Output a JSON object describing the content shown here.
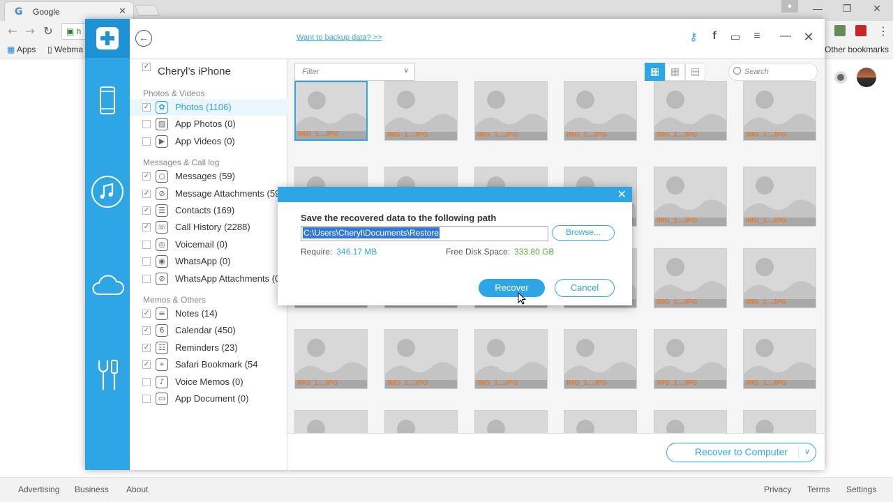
{
  "browser": {
    "tab_title": "Google",
    "tab_close": "✕",
    "favicon": "G",
    "omnibox_text": "h",
    "window_controls": [
      "—",
      "❐",
      "✕"
    ],
    "profile_icon": "person-icon",
    "bookmarks": {
      "apps": "Apps",
      "webmail": "Webma",
      "other": "Other bookmarks"
    }
  },
  "page_footer": {
    "left_links": [
      "Advertising",
      "Business",
      "About"
    ],
    "right_links": [
      "Privacy",
      "Terms",
      "Settings"
    ]
  },
  "app": {
    "header": {
      "back_icon": "arrow-left-icon",
      "backup_link": "Want to backup data? >>",
      "icons": [
        "key-icon",
        "facebook-icon",
        "feedback-icon",
        "menu-icon",
        "minimize-icon",
        "close-icon"
      ]
    },
    "sidebar_icons": [
      "logo-plus-icon",
      "phone-icon",
      "music-icon",
      "cloud-icon",
      "tools-icon"
    ],
    "accent_color": "#2ea6e5",
    "device": {
      "name": "Cheryl’s iPhone",
      "checked": true
    },
    "sections": [
      {
        "title": "Photos & Videos",
        "items": [
          {
            "label": "Photos (1106)",
            "checked": true,
            "selected": true,
            "icon": "photos-icon"
          },
          {
            "label": "App Photos (0)",
            "checked": false,
            "icon": "app-photos-icon"
          },
          {
            "label": "App Videos (0)",
            "checked": false,
            "icon": "app-videos-icon"
          }
        ]
      },
      {
        "title": "Messages & Call log",
        "items": [
          {
            "label": "Messages (59)",
            "checked": true,
            "icon": "messages-icon"
          },
          {
            "label": "Message Attachments (59)",
            "checked": true,
            "icon": "attachment-icon"
          },
          {
            "label": "Contacts (169)",
            "checked": true,
            "icon": "contacts-icon"
          },
          {
            "label": "Call History (2288)",
            "checked": true,
            "icon": "phone-call-icon"
          },
          {
            "label": "Voicemail (0)",
            "checked": false,
            "icon": "voicemail-icon"
          },
          {
            "label": "WhatsApp (0)",
            "checked": false,
            "icon": "whatsapp-icon"
          },
          {
            "label": "WhatsApp Attachments (0)",
            "checked": false,
            "icon": "attachment-icon"
          }
        ]
      },
      {
        "title": "Memos & Others",
        "items": [
          {
            "label": "Notes (14)",
            "checked": true,
            "icon": "notes-icon"
          },
          {
            "label": "Calendar (450)",
            "checked": true,
            "icon": "calendar-icon"
          },
          {
            "label": "Reminders (23)",
            "checked": true,
            "icon": "reminders-icon"
          },
          {
            "label": "Safari Bookmark (54",
            "checked": true,
            "icon": "safari-icon"
          },
          {
            "label": "Voice Memos (0)",
            "checked": false,
            "icon": "voice-memo-icon"
          },
          {
            "label": "App Document (0)",
            "checked": false,
            "icon": "document-icon"
          }
        ]
      }
    ],
    "content": {
      "filter_placeholder": "Filter",
      "search_placeholder": "Search",
      "view_modes": [
        "large-grid-icon",
        "small-grid-icon",
        "list-icon"
      ],
      "thumb_name": "IMG_1...JPG",
      "thumb_ext": "JPG"
    },
    "recover_to_computer": "Recover to Computer",
    "dialog": {
      "close": "✕",
      "title": "Save the recovered data to the following path",
      "path": "C:\\Users\\Cheryl\\Documents\\Restore",
      "browse": "Browse...",
      "require_label": "Require:",
      "require_value": "346.17 MB",
      "free_label": "Free Disk Space:",
      "free_value": "333.80 GB",
      "recover": "Recover",
      "cancel": "Cancel"
    }
  }
}
